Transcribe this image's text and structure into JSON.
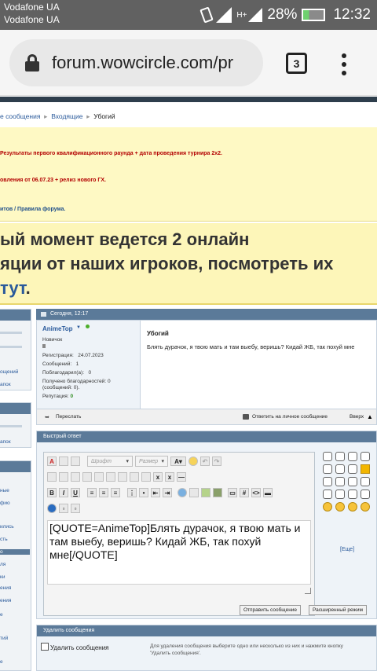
{
  "status_bar": {
    "carrier_1": "Vodafone UA",
    "carrier_2": "Vodafone UA",
    "network": "H+",
    "battery": "28%",
    "time": "12:32"
  },
  "browser": {
    "url": "forum.wowcircle.com/pr",
    "tab_count": "3"
  },
  "breadcrumb": {
    "item_1": "е сообщения",
    "item_2": "Входящие",
    "current": "Убогий"
  },
  "notice": {
    "line_1": "",
    "line_2": "Результаты первого квалификационного раунда + дата проведения турнира 2х2.",
    "line_3": "овления от 06.07.23 + релиз нового ГХ.",
    "line_4": "итов / Правила форума."
  },
  "banner": {
    "line_1": "ый момент ведется 2 онлайн",
    "line_2": "яции от наших игроков, посмотреть их",
    "link": "тут",
    "suffix": "."
  },
  "sidebar": {
    "group_1": [
      "ощений",
      "апок"
    ],
    "group_2": [
      "апок"
    ],
    "group_3": [
      "ные",
      "фио",
      "ились",
      "сть",
      "о",
      "ля",
      "ки",
      "ения",
      "ения",
      "е",
      "тий",
      "е"
    ]
  },
  "post": {
    "date": "Сегодня, 12:17",
    "author": "AnimeTop",
    "rank": "Новичок",
    "registration_label": "Регистрация:",
    "registration_value": "24.07.2023",
    "messages_label": "Сообщений:",
    "messages_value": "1",
    "thanked_label": "Поблагодарил(а):",
    "thanked_value": "0",
    "received_label": "Получено благодарностей: 0",
    "received_sub": "(сообщений: 0).",
    "reputation_label": "Репутация:",
    "reputation_value": "0",
    "title": "Убогий",
    "text": "Блять дурачок, я твою мать и там выебу, веришь? Кидай ЖБ, так похуй мне",
    "forward": "Переслать",
    "reply_private": "Ответить на личное сообщение",
    "up": "Вверх"
  },
  "quick_reply": {
    "title": "Быстрый ответ",
    "font_placeholder": "Шрифт",
    "size_placeholder": "Размер",
    "text": "[QUOTE=AnimeTop]Блять дурачок, я твою мать и там выебу, веришь? Кидай ЖБ, так похуй мне[/QUOTE]",
    "more_smilies": "[Еще]",
    "send": "Отправить сообщение",
    "advanced": "Расширенный режим"
  },
  "delete_section": {
    "title": "Удалить сообщения",
    "checkbox_label": "Удалить сообщения",
    "description_1": "Для удаления сообщения выберите одно или несколько из них и нажмите кнопку",
    "description_2": "'Удалить сообщения'."
  },
  "colors": {
    "header_blue": "#5b7a99",
    "link_blue": "#2a5a9b",
    "notice_yellow": "#fef9c4",
    "status_bar": "#616161"
  }
}
